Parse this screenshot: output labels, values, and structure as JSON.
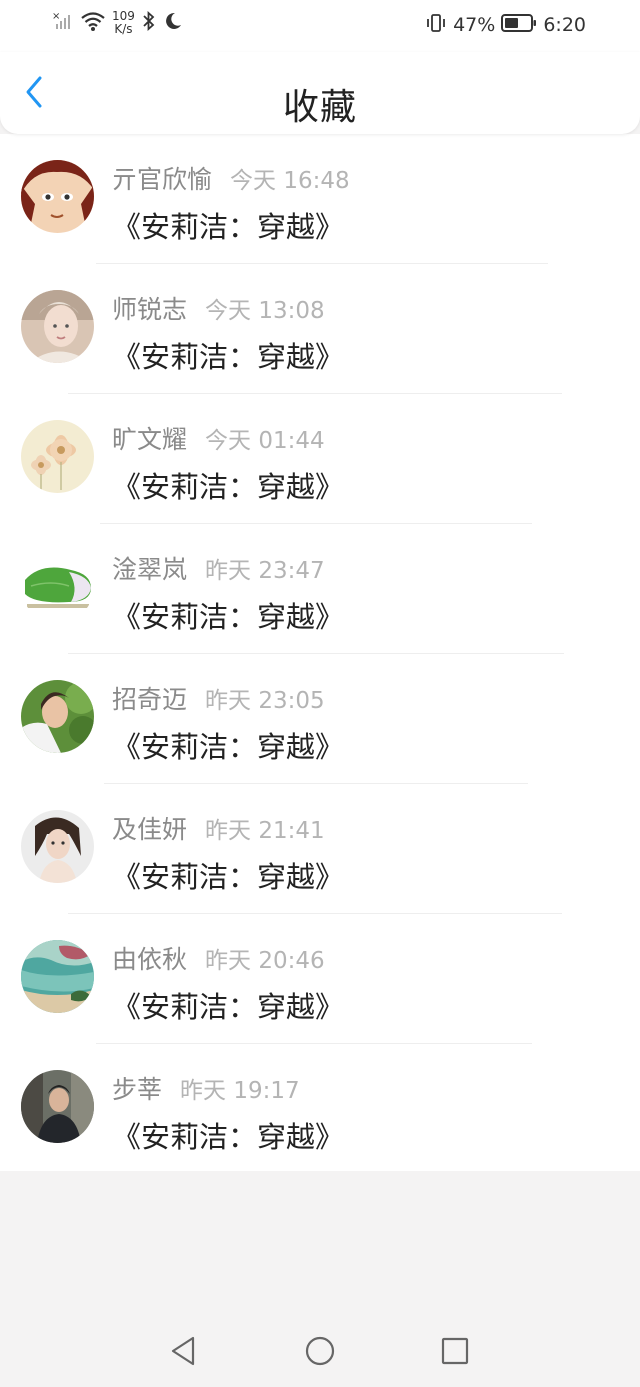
{
  "status_bar": {
    "speed_value": "109",
    "speed_unit": "K/s",
    "battery_percent": "47%",
    "time": "6:20",
    "icons": [
      "signal-icon",
      "wifi-icon",
      "bluetooth-icon",
      "moon-icon",
      "vibrate-icon",
      "battery-icon"
    ]
  },
  "header": {
    "title": "收藏",
    "back_icon": "chevron-left-icon",
    "accent_color": "#2196f3"
  },
  "items": [
    {
      "author": "亓官欣愉",
      "time": "今天 16:48",
      "book": "《安莉洁：穿越》"
    },
    {
      "author": "师锐志",
      "time": "今天 13:08",
      "book": "《安莉洁：穿越》"
    },
    {
      "author": "旷文耀",
      "time": "今天 01:44",
      "book": "《安莉洁：穿越》"
    },
    {
      "author": "淦翠岚",
      "time": "昨天 23:47",
      "book": "《安莉洁：穿越》"
    },
    {
      "author": "招奇迈",
      "time": "昨天 23:05",
      "book": "《安莉洁：穿越》"
    },
    {
      "author": "及佳妍",
      "time": "昨天 21:41",
      "book": "《安莉洁：穿越》"
    },
    {
      "author": "由依秋",
      "time": "昨天 20:46",
      "book": "《安莉洁：穿越》"
    },
    {
      "author": "步莘",
      "time": "昨天 19:17",
      "book": "《安莉洁：穿越》"
    }
  ],
  "nav_bar": {
    "back_icon": "triangle-back-icon",
    "home_icon": "circle-home-icon",
    "recents_icon": "square-recents-icon"
  }
}
